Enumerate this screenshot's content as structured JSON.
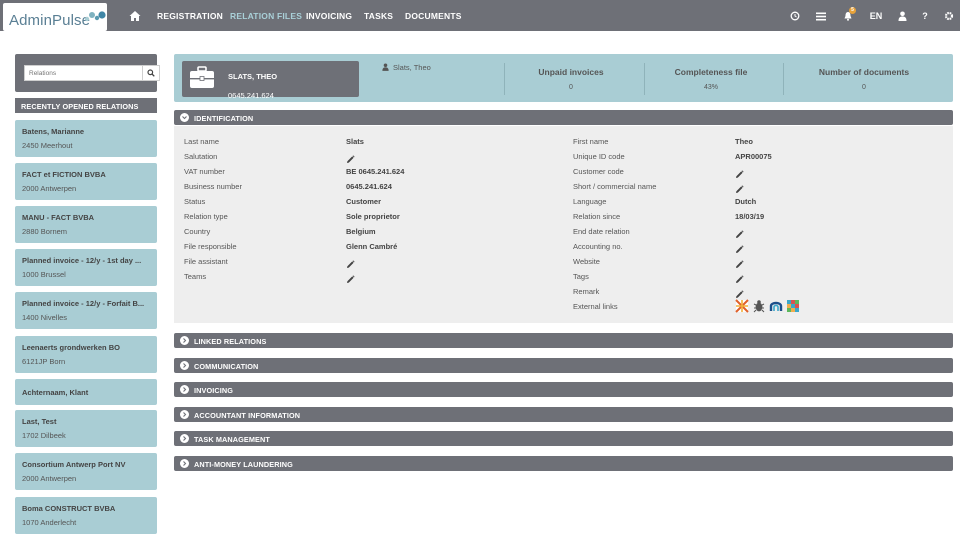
{
  "app": {
    "logo_text": "AdminPulse"
  },
  "nav": {
    "items": [
      "REGISTRATION",
      "RELATION FILES",
      "INVOICING",
      "TASKS",
      "DOCUMENTS"
    ],
    "language": "EN",
    "help": "?",
    "notification_count": "5",
    "icons": [
      "home-icon",
      "clock-icon",
      "list-icon",
      "bell-icon",
      "user-icon",
      "help-icon",
      "gear-icon"
    ]
  },
  "sidebar": {
    "search_placeholder": "Relations",
    "heading": "RECENTLY OPENED RELATIONS",
    "items": [
      {
        "name": "Batens, Marianne",
        "city": "2450 Meerhout"
      },
      {
        "name": "FACT et FICTION BVBA",
        "city": "2000 Antwerpen"
      },
      {
        "name": "MANU - FACT BVBA",
        "city": "2880 Bornem"
      },
      {
        "name": "Planned invoice - 12/y - 1st day ...",
        "city": "1000 Brussel"
      },
      {
        "name": "Planned invoice - 12/y - Forfait B...",
        "city": "1400 Nivelles"
      },
      {
        "name": "Leenaerts grondwerken BO",
        "city": "6121JP Born"
      },
      {
        "name": "Achternaam, Klant",
        "city": ""
      },
      {
        "name": "Last, Test",
        "city": "1702 Dilbeek"
      },
      {
        "name": "Consortium Antwerp Port NV",
        "city": "2000 Antwerpen"
      },
      {
        "name": "Boma CONSTRUCT BVBA",
        "city": "1070 Anderlecht"
      }
    ]
  },
  "header": {
    "card_name": "SLATS, THEO",
    "card_vat": "0645.241.624",
    "person_name": "Slats, Theo",
    "stats": [
      {
        "label": "Unpaid invoices",
        "value": "0"
      },
      {
        "label": "Completeness file",
        "value": "43%"
      },
      {
        "label": "Number of documents",
        "value": "0"
      }
    ]
  },
  "identification": {
    "title": "IDENTIFICATION",
    "left": [
      {
        "label": "Last name",
        "value": "Slats"
      },
      {
        "label": "Salutation",
        "value": ""
      },
      {
        "label": "VAT number",
        "value": "BE 0645.241.624"
      },
      {
        "label": "Business number",
        "value": "0645.241.624"
      },
      {
        "label": "Status",
        "value": "Customer"
      },
      {
        "label": "Relation type",
        "value": "Sole proprietor"
      },
      {
        "label": "Country",
        "value": "Belgium"
      },
      {
        "label": "File responsible",
        "value": "Glenn Cambré"
      },
      {
        "label": "File assistant",
        "value": ""
      },
      {
        "label": "Teams",
        "value": ""
      }
    ],
    "right": [
      {
        "label": "First name",
        "value": "Theo"
      },
      {
        "label": "Unique ID code",
        "value": "APR00075"
      },
      {
        "label": "Customer code",
        "value": ""
      },
      {
        "label": "Short / commercial name",
        "value": ""
      },
      {
        "label": "Language",
        "value": "Dutch"
      },
      {
        "label": "Relation since",
        "value": "18/03/19"
      },
      {
        "label": "End date relation",
        "value": ""
      },
      {
        "label": "Accounting no.",
        "value": ""
      },
      {
        "label": "Website",
        "value": ""
      },
      {
        "label": "Tags",
        "value": ""
      },
      {
        "label": "Remark",
        "value": ""
      },
      {
        "label": "External links",
        "value": ""
      }
    ]
  },
  "sections": [
    "LINKED RELATIONS",
    "COMMUNICATION",
    "INVOICING",
    "ACCOUNTANT INFORMATION",
    "TASK MANAGEMENT",
    "ANTI-MONEY LAUNDERING"
  ],
  "colors": {
    "nav": "#6e7077",
    "accent": "#a9cdd4",
    "panel": "#eeeeee"
  }
}
